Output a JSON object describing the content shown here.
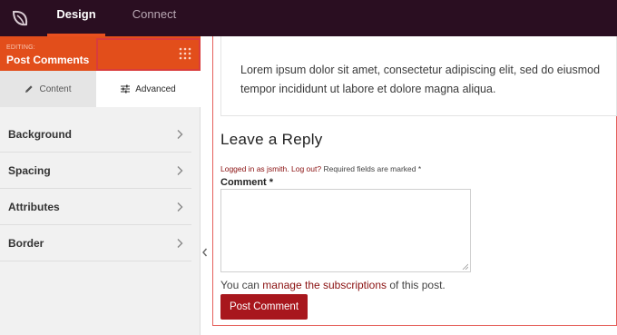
{
  "topbar": {
    "tabs": [
      {
        "label": "Design",
        "active": true
      },
      {
        "label": "Connect",
        "active": false
      }
    ],
    "logo_icon": "leaf-logo-icon"
  },
  "sidebar": {
    "editing_label": "EDITING:",
    "editing_title": "Post Comments",
    "subtabs": [
      {
        "label": "Content",
        "icon": "pencil-icon"
      },
      {
        "label": "Advanced",
        "icon": "sliders-icon",
        "active": true
      }
    ],
    "sections": [
      {
        "label": "Background"
      },
      {
        "label": "Spacing"
      },
      {
        "label": "Attributes"
      },
      {
        "label": "Border"
      }
    ]
  },
  "preview": {
    "lorem": "Lorem ipsum dolor sit amet, consectetur adipiscing elit, sed do eiusmod tempor incididunt ut labore et dolore magna aliqua.",
    "reply_title": "Leave a Reply",
    "logged_in": "Logged in as jsmith.",
    "log_out": "Log out?",
    "required": "Required fields are marked *",
    "comment_label": "Comment *",
    "subs_prefix": "You can",
    "subs_link": "manage the subscriptions",
    "subs_suffix": "of this post.",
    "post_button": "Post Comment"
  },
  "colors": {
    "topbar": "#2a0e21",
    "accent": "#e24e1b",
    "highlight": "#d93c3c",
    "button": "#a8171d",
    "link": "#8a1010"
  }
}
